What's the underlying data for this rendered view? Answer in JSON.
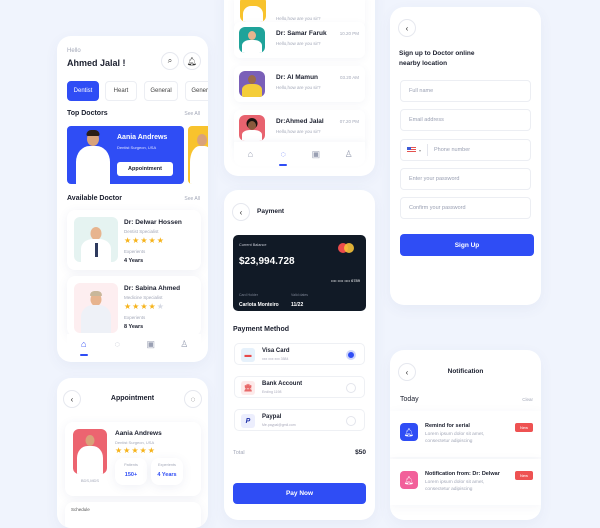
{
  "home": {
    "greeting": "Hello",
    "user_name": "Ahmed Jalal !",
    "categories": [
      {
        "label": "Dentist",
        "active": true
      },
      {
        "label": "Heart",
        "active": false
      },
      {
        "label": "General",
        "active": false
      },
      {
        "label": "General",
        "active": false
      }
    ],
    "top_doctors_title": "Top Doctors",
    "see_all": "See All",
    "featured": {
      "name": "Aania Andrews",
      "specialty": "Dentist Surgeon, USA",
      "button": "Appointment",
      "bg": "#2f4df5"
    },
    "available_title": "Available Doctor",
    "available": [
      {
        "name": "Dr: Delwar Hossen",
        "specialty": "Dentist Specialist",
        "rating": 5,
        "exp_label": "Experients",
        "exp_value": "4 Years"
      },
      {
        "name": "Dr: Sabina  Ahmed",
        "specialty": "Medicine Specialist",
        "rating": 4,
        "exp_label": "Experients",
        "exp_value": "8 Years"
      }
    ],
    "nav": [
      "home-icon",
      "chat-icon",
      "calendar-icon",
      "profile-icon"
    ]
  },
  "appointment": {
    "title": "Appointment",
    "doctor_name": "Aania Andrews",
    "specialty": "Dentist Surgeon, USA",
    "degree": "BDS,MDS",
    "rating": 5,
    "patients_label": "Patients",
    "patients_value": "150+",
    "experience_label": "Experients",
    "experience_value": "4 Years",
    "next_section_partial": "Schedule"
  },
  "chats": {
    "partial_top_text": "Hello,how are you sir?",
    "messages": [
      {
        "name": "Dr: Samar Faruk",
        "text": "Hello,how are you sir?",
        "time": "10.20 PM",
        "color": "#1fa39a"
      },
      {
        "name": "Dr: Al Mamun",
        "text": "Hello,how are you sir?",
        "time": "03.20 AM",
        "color": "#7a5fb8"
      },
      {
        "name": "Dr:Ahmed Jalal",
        "text": "Hello,how are you sir?",
        "time": "07.20 PM",
        "color": "#e8636f"
      }
    ]
  },
  "payment": {
    "title": "Payment",
    "card": {
      "balance_label": "Current Balance",
      "balance": "$23,994.728",
      "masked_number": "•••• •••• •••• 6789",
      "holder_label": "Card Holder",
      "holder": "Carlota Monteiro",
      "valid_label": "Valid dates",
      "valid": "11/22"
    },
    "method_title": "Payment Method",
    "methods": [
      {
        "name": "Visa Card",
        "sub": "xxx xxx xxx 3584",
        "selected": true
      },
      {
        "name": "Bank Account",
        "sub": "Ending 1198",
        "selected": false
      },
      {
        "name": "Paypal",
        "sub": "Me.paypal@gmil.com",
        "selected": false
      }
    ],
    "total_label": "Total",
    "total_value": "$50",
    "pay_button": "Pay Now"
  },
  "signup": {
    "title_line1": "Sign up to Doctor online",
    "title_line2": "nearby location",
    "full_name_placeholder": "Full name",
    "email_placeholder": "Email address",
    "phone_placeholder": "Phone number",
    "password_placeholder": "Enter your password",
    "confirm_placeholder": "Confirm your password",
    "button": "Sign Up"
  },
  "notification": {
    "title": "Notification",
    "section": "Today",
    "clear": "Clear",
    "items": [
      {
        "title": "Remind for serial",
        "text": "Lorem ipsum dolor sit amet, consectetur adipiscing",
        "badge": "New",
        "color": "#2f4df5"
      },
      {
        "title": "Notification from: Dr: Delwar",
        "text": "Lorem ipsum dolor sit amet, consectetur adipiscing",
        "badge": "New",
        "color": "#f2609a"
      }
    ]
  },
  "colors": {
    "primary": "#2f4df5",
    "accent_yellow": "#f6b31a",
    "danger": "#ee5252",
    "card_dark": "#111a26"
  }
}
